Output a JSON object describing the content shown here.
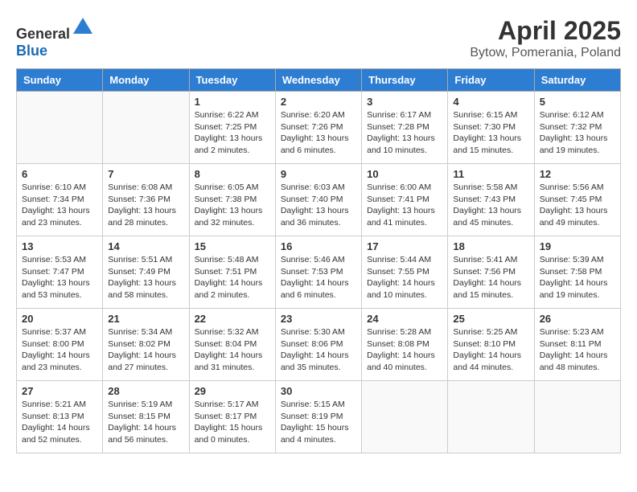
{
  "header": {
    "logo_general": "General",
    "logo_blue": "Blue",
    "title": "April 2025",
    "location": "Bytow, Pomerania, Poland"
  },
  "calendar": {
    "days_of_week": [
      "Sunday",
      "Monday",
      "Tuesday",
      "Wednesday",
      "Thursday",
      "Friday",
      "Saturday"
    ],
    "weeks": [
      [
        {
          "day": "",
          "content": ""
        },
        {
          "day": "",
          "content": ""
        },
        {
          "day": "1",
          "content": "Sunrise: 6:22 AM\nSunset: 7:25 PM\nDaylight: 13 hours\nand 2 minutes."
        },
        {
          "day": "2",
          "content": "Sunrise: 6:20 AM\nSunset: 7:26 PM\nDaylight: 13 hours\nand 6 minutes."
        },
        {
          "day": "3",
          "content": "Sunrise: 6:17 AM\nSunset: 7:28 PM\nDaylight: 13 hours\nand 10 minutes."
        },
        {
          "day": "4",
          "content": "Sunrise: 6:15 AM\nSunset: 7:30 PM\nDaylight: 13 hours\nand 15 minutes."
        },
        {
          "day": "5",
          "content": "Sunrise: 6:12 AM\nSunset: 7:32 PM\nDaylight: 13 hours\nand 19 minutes."
        }
      ],
      [
        {
          "day": "6",
          "content": "Sunrise: 6:10 AM\nSunset: 7:34 PM\nDaylight: 13 hours\nand 23 minutes."
        },
        {
          "day": "7",
          "content": "Sunrise: 6:08 AM\nSunset: 7:36 PM\nDaylight: 13 hours\nand 28 minutes."
        },
        {
          "day": "8",
          "content": "Sunrise: 6:05 AM\nSunset: 7:38 PM\nDaylight: 13 hours\nand 32 minutes."
        },
        {
          "day": "9",
          "content": "Sunrise: 6:03 AM\nSunset: 7:40 PM\nDaylight: 13 hours\nand 36 minutes."
        },
        {
          "day": "10",
          "content": "Sunrise: 6:00 AM\nSunset: 7:41 PM\nDaylight: 13 hours\nand 41 minutes."
        },
        {
          "day": "11",
          "content": "Sunrise: 5:58 AM\nSunset: 7:43 PM\nDaylight: 13 hours\nand 45 minutes."
        },
        {
          "day": "12",
          "content": "Sunrise: 5:56 AM\nSunset: 7:45 PM\nDaylight: 13 hours\nand 49 minutes."
        }
      ],
      [
        {
          "day": "13",
          "content": "Sunrise: 5:53 AM\nSunset: 7:47 PM\nDaylight: 13 hours\nand 53 minutes."
        },
        {
          "day": "14",
          "content": "Sunrise: 5:51 AM\nSunset: 7:49 PM\nDaylight: 13 hours\nand 58 minutes."
        },
        {
          "day": "15",
          "content": "Sunrise: 5:48 AM\nSunset: 7:51 PM\nDaylight: 14 hours\nand 2 minutes."
        },
        {
          "day": "16",
          "content": "Sunrise: 5:46 AM\nSunset: 7:53 PM\nDaylight: 14 hours\nand 6 minutes."
        },
        {
          "day": "17",
          "content": "Sunrise: 5:44 AM\nSunset: 7:55 PM\nDaylight: 14 hours\nand 10 minutes."
        },
        {
          "day": "18",
          "content": "Sunrise: 5:41 AM\nSunset: 7:56 PM\nDaylight: 14 hours\nand 15 minutes."
        },
        {
          "day": "19",
          "content": "Sunrise: 5:39 AM\nSunset: 7:58 PM\nDaylight: 14 hours\nand 19 minutes."
        }
      ],
      [
        {
          "day": "20",
          "content": "Sunrise: 5:37 AM\nSunset: 8:00 PM\nDaylight: 14 hours\nand 23 minutes."
        },
        {
          "day": "21",
          "content": "Sunrise: 5:34 AM\nSunset: 8:02 PM\nDaylight: 14 hours\nand 27 minutes."
        },
        {
          "day": "22",
          "content": "Sunrise: 5:32 AM\nSunset: 8:04 PM\nDaylight: 14 hours\nand 31 minutes."
        },
        {
          "day": "23",
          "content": "Sunrise: 5:30 AM\nSunset: 8:06 PM\nDaylight: 14 hours\nand 35 minutes."
        },
        {
          "day": "24",
          "content": "Sunrise: 5:28 AM\nSunset: 8:08 PM\nDaylight: 14 hours\nand 40 minutes."
        },
        {
          "day": "25",
          "content": "Sunrise: 5:25 AM\nSunset: 8:10 PM\nDaylight: 14 hours\nand 44 minutes."
        },
        {
          "day": "26",
          "content": "Sunrise: 5:23 AM\nSunset: 8:11 PM\nDaylight: 14 hours\nand 48 minutes."
        }
      ],
      [
        {
          "day": "27",
          "content": "Sunrise: 5:21 AM\nSunset: 8:13 PM\nDaylight: 14 hours\nand 52 minutes."
        },
        {
          "day": "28",
          "content": "Sunrise: 5:19 AM\nSunset: 8:15 PM\nDaylight: 14 hours\nand 56 minutes."
        },
        {
          "day": "29",
          "content": "Sunrise: 5:17 AM\nSunset: 8:17 PM\nDaylight: 15 hours\nand 0 minutes."
        },
        {
          "day": "30",
          "content": "Sunrise: 5:15 AM\nSunset: 8:19 PM\nDaylight: 15 hours\nand 4 minutes."
        },
        {
          "day": "",
          "content": ""
        },
        {
          "day": "",
          "content": ""
        },
        {
          "day": "",
          "content": ""
        }
      ]
    ]
  }
}
